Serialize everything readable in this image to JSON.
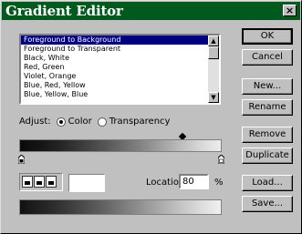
{
  "window": {
    "title": "Gradient Editor",
    "close_glyph": "×"
  },
  "gradient_list": {
    "items": [
      "Foreground to Background",
      "Foreground to Transparent",
      "Black, White",
      "Red, Green",
      "Violet, Orange",
      "Blue, Red, Yellow",
      "Blue, Yellow, Blue"
    ],
    "selected_index": 0
  },
  "adjust": {
    "label": "Adjust:",
    "option_color": "Color",
    "option_transparency": "Transparency",
    "selected": "Color"
  },
  "location": {
    "label": "Location:",
    "value": "80",
    "unit": "%"
  },
  "buttons": {
    "ok": "OK",
    "cancel": "Cancel",
    "new": "New...",
    "rename": "Rename",
    "remove": "Remove",
    "duplicate": "Duplicate",
    "load": "Load...",
    "save": "Save..."
  },
  "colors": {
    "title_bar": "#005a1e",
    "selection": "#000080",
    "face": "#c0c0c0"
  },
  "icons": {
    "scroll_up": "▲",
    "scroll_down": "▼"
  }
}
